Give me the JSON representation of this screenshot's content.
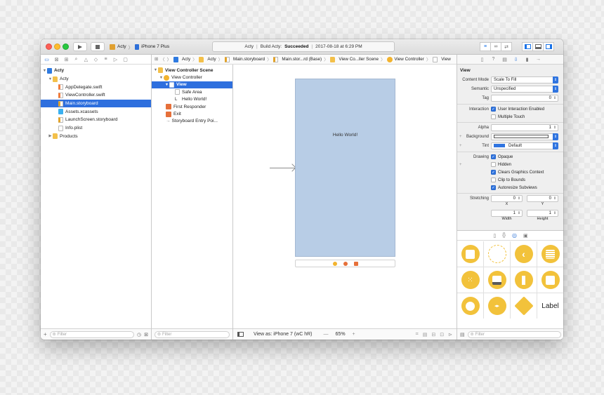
{
  "toolbar": {
    "scheme_project": "Acty",
    "scheme_device": "iPhone 7 Plus",
    "status_project": "Acty",
    "status_build_prefix": "Build Acty:",
    "status_build_result": "Succeeded",
    "status_time": "2017-08-18 at 6:29 PM"
  },
  "navigator": {
    "items": [
      {
        "label": "Acty",
        "type": "project",
        "disclosure": "▼"
      },
      {
        "label": "Acty",
        "type": "folder",
        "disclosure": "▼"
      },
      {
        "label": "AppDelegate.swift",
        "type": "swift"
      },
      {
        "label": "ViewController.swift",
        "type": "swift"
      },
      {
        "label": "Main.storyboard",
        "type": "storyboard",
        "selected": true
      },
      {
        "label": "Assets.xcassets",
        "type": "assets"
      },
      {
        "label": "LaunchScreen.storyboard",
        "type": "storyboard"
      },
      {
        "label": "Info.plist",
        "type": "file"
      },
      {
        "label": "Products",
        "type": "folder",
        "disclosure": "▶"
      }
    ],
    "filter_placeholder": "Filter"
  },
  "jumpbar": {
    "crumbs": [
      "Acty",
      "Acty",
      "Main.storyboard",
      "Main.stor...rd (Base)",
      "View Co...ller Scene",
      "View Controller",
      "View"
    ]
  },
  "outline": {
    "items": [
      {
        "label": "View Controller Scene",
        "bold": true
      },
      {
        "label": "View Controller"
      },
      {
        "label": "View",
        "selected": true,
        "bold": true
      },
      {
        "label": "Safe Area"
      },
      {
        "label": "Hello World!",
        "prefix": "L"
      },
      {
        "label": "First Responder"
      },
      {
        "label": "Exit"
      },
      {
        "label": "Storyboard Entry Poi..."
      }
    ],
    "filter_placeholder": "Filter"
  },
  "canvas": {
    "label_text": "Hello World!",
    "view_as": "View as: iPhone 7 (wC hR)",
    "zoom": "65%",
    "zoom_minus": "—",
    "zoom_plus": "+"
  },
  "inspector": {
    "title": "View",
    "content_mode_label": "Content Mode",
    "content_mode_value": "Scale To Fill",
    "semantic_label": "Semantic",
    "semantic_value": "Unspecified",
    "tag_label": "Tag",
    "tag_value": "0",
    "interaction_label": "Interaction",
    "user_interaction": "User Interaction Enabled",
    "multiple_touch": "Multiple Touch",
    "alpha_label": "Alpha",
    "alpha_value": "1",
    "background_label": "Background",
    "tint_label": "Tint",
    "tint_value": "Default",
    "drawing_label": "Drawing",
    "opaque": "Opaque",
    "hidden": "Hidden",
    "clears_graphics": "Clears Graphics Context",
    "clip_to_bounds": "Clip to Bounds",
    "autoresize": "Autoresize Subviews",
    "stretching_label": "Stretching",
    "stretch_x": "0",
    "stretch_y": "0",
    "stretch_w": "1",
    "stretch_h": "1",
    "x_label": "X",
    "y_label": "Y",
    "width_label": "Width",
    "height_label": "Height",
    "library_label_text": "Label",
    "filter_placeholder": "Filter"
  },
  "colors": {
    "accent": "#2e6fde",
    "view_background": "#b8cde6",
    "library_yellow": "#f2c23b",
    "tint_swatch": "#2f74e0"
  }
}
